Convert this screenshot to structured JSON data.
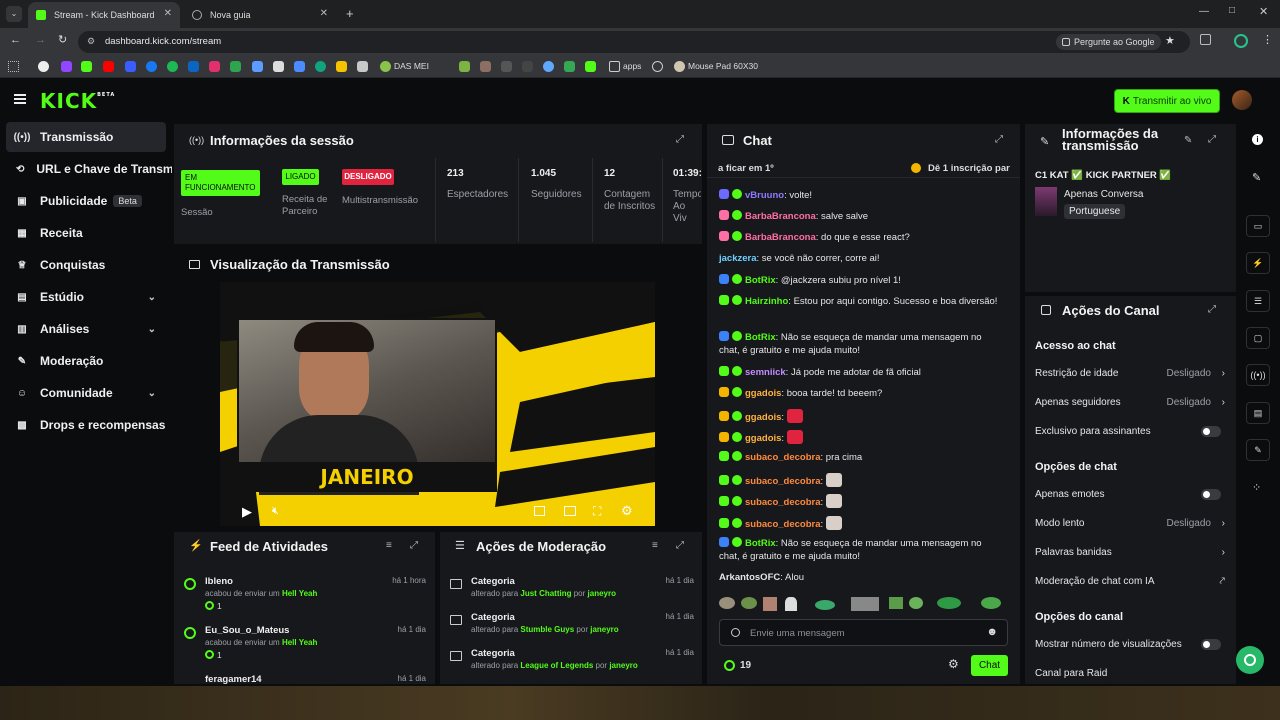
{
  "browser": {
    "tabs": [
      {
        "title": "Stream - Kick Dashboard",
        "active": true
      },
      {
        "title": "Nova guia",
        "active": false
      }
    ],
    "url": "dashboard.kick.com/stream",
    "ask_google": "Pergunte ao Google",
    "bookmarks": [
      "DAS MEI",
      "apps",
      "Mouse Pad 60X30"
    ]
  },
  "topnav": {
    "logo": "KICK",
    "logo_sup": "BETA",
    "go_live": "Transmitir ao vivo"
  },
  "sidebar": {
    "items": [
      {
        "label": "Transmissão",
        "icon": "broadcast-icon",
        "active": true
      },
      {
        "label": "URL e Chave de Transmissão",
        "icon": "link-icon"
      },
      {
        "label": "Publicidade",
        "icon": "ads-icon",
        "badge": "Beta"
      },
      {
        "label": "Receita",
        "icon": "revenue-icon"
      },
      {
        "label": "Conquistas",
        "icon": "trophy-icon"
      },
      {
        "label": "Estúdio",
        "icon": "studio-icon",
        "chevron": true
      },
      {
        "label": "Análises",
        "icon": "analytics-icon",
        "chevron": true
      },
      {
        "label": "Moderação",
        "icon": "wrench-icon"
      },
      {
        "label": "Comunidade",
        "icon": "community-icon",
        "chevron": true
      },
      {
        "label": "Drops e recompensas",
        "icon": "gift-icon"
      }
    ]
  },
  "session": {
    "title": "Informações da sessão",
    "status_badges": [
      {
        "badge": "EM FUNCIONAMENTO",
        "label": "Sessão"
      },
      {
        "badge": "LIGADO",
        "label": "Receita de Parceiro"
      },
      {
        "badge": "DESLIGADO",
        "label": "Multistransmissão"
      }
    ],
    "stats": [
      {
        "value": "213",
        "label": "Espectadores"
      },
      {
        "value": "1.045",
        "label": "Seguidores"
      },
      {
        "value": "12",
        "label": "Contagem de Inscritos"
      },
      {
        "value": "01:39:",
        "label": "Tempo Ao Viv"
      }
    ]
  },
  "preview": {
    "title": "Visualização da Transmissão",
    "overlay_text": "JANEIRO"
  },
  "activity": {
    "title": "Feed de Atividades",
    "items": [
      {
        "user": "lbleno",
        "time": "há 1 hora",
        "action": "acabou de enviar um",
        "item": "Hell Yeah",
        "count": "1"
      },
      {
        "user": "Eu_Sou_o_Mateus",
        "time": "há 1 dia",
        "action": "acabou de enviar um",
        "item": "Hell Yeah",
        "count": "1"
      },
      {
        "user": "feragamer14",
        "time": "há 1 dia"
      }
    ]
  },
  "moderation": {
    "title": "Ações de Moderação",
    "items": [
      {
        "title": "Categoria",
        "time": "há 1 dia",
        "prefix": "alterado para",
        "target": "Just Chatting",
        "by": "por",
        "user": "janeyro"
      },
      {
        "title": "Categoria",
        "time": "há 1 dia",
        "prefix": "alterado para",
        "target": "Stumble Guys",
        "by": "por",
        "user": "janeyro"
      },
      {
        "title": "Categoria",
        "time": "há 1 dia",
        "prefix": "alterado para",
        "target": "League of Legends",
        "by": "por",
        "user": "janeyro"
      }
    ]
  },
  "chat": {
    "title": "Chat",
    "pinned_left": "a ficar em 1º",
    "pinned_right": "Dê 1 inscrição par",
    "messages": [
      {
        "user": "vBruuno",
        "color": "#8b7bff",
        "text": "volte!"
      },
      {
        "user": "BarbaBrancona",
        "color": "#ff6fa5",
        "text": "salve salve"
      },
      {
        "user": "BarbaBrancona",
        "color": "#ff6fa5",
        "text": "do que e esse react?"
      },
      {
        "user": "jackzera",
        "color": "#6fd0ff",
        "text": "se você não correr, corre ai!"
      },
      {
        "user": "BotRix",
        "color": "#53fc18",
        "text": "@jackzera subiu pro nível 1!"
      },
      {
        "user": "Hairzinho",
        "color": "#53fc18",
        "text": "Estou por aqui contigo. Sucesso e boa diversão!"
      },
      {
        "user": "BotRix",
        "color": "#53fc18",
        "text": "Não se esqueça de mandar uma mensagem no"
      },
      {
        "user": "",
        "color": "#e6e6e6",
        "text": "chat, é gratuito e me ajuda muito!"
      },
      {
        "user": "semniick",
        "color": "#c58cff",
        "text": "Já pode me adotar de fã oficial"
      },
      {
        "user": "ggadois",
        "color": "#ffb23f",
        "text": "booa tarde! td beeem?"
      },
      {
        "user": "ggadois",
        "color": "#ffb23f",
        "text": ""
      },
      {
        "user": "ggadois",
        "color": "#ffb23f",
        "text": ""
      },
      {
        "user": "subaco_decobra",
        "color": "#ff8a3d",
        "text": "pra cima"
      },
      {
        "user": "subaco_decobra",
        "color": "#ff8a3d",
        "text": ""
      },
      {
        "user": "subaco_decobra",
        "color": "#ff8a3d",
        "text": ""
      },
      {
        "user": "subaco_decobra",
        "color": "#ff8a3d",
        "text": ""
      },
      {
        "user": "BotRix",
        "color": "#53fc18",
        "text": "Não se esqueça de mandar uma mensagem no"
      },
      {
        "user": "",
        "color": "#e6e6e6",
        "text": "chat, é gratuito e me ajuda muito!"
      },
      {
        "user": "ArkantosOFC",
        "color": "#e6e6e6",
        "text": "Alou"
      }
    ],
    "input_placeholder": "Envie uma mensagem",
    "points": "19",
    "send": "Chat"
  },
  "stream_info": {
    "title": "Informações da transmissão",
    "stream_title": "C1 KAT ✅ KICK PARTNER ✅",
    "category": "Apenas Conversa",
    "language": "Portuguese"
  },
  "channel_actions": {
    "title": "Ações do Canal",
    "sections": [
      {
        "heading": "Acesso ao chat",
        "rows": [
          {
            "label": "Restrição de idade",
            "value": "Desligado",
            "kind": "chevron"
          },
          {
            "label": "Apenas seguidores",
            "value": "Desligado",
            "kind": "chevron"
          },
          {
            "label": "Exclusivo para assinantes",
            "kind": "toggle"
          }
        ]
      },
      {
        "heading": "Opções de chat",
        "rows": [
          {
            "label": "Apenas emotes",
            "kind": "toggle"
          },
          {
            "label": "Modo lento",
            "value": "Desligado",
            "kind": "chevron"
          },
          {
            "label": "Palavras banidas",
            "kind": "chevron"
          },
          {
            "label": "Moderação de chat com IA",
            "kind": "external"
          }
        ]
      },
      {
        "heading": "Opções do canal",
        "rows": [
          {
            "label": "Mostrar número de visualizações",
            "kind": "toggle"
          },
          {
            "label": "Canal para Raid",
            "kind": "none"
          }
        ]
      }
    ]
  },
  "colors": {
    "accent": "#53fc18",
    "bg": "#0b0c0e",
    "panel": "#17181c",
    "off": "#e0243f"
  }
}
